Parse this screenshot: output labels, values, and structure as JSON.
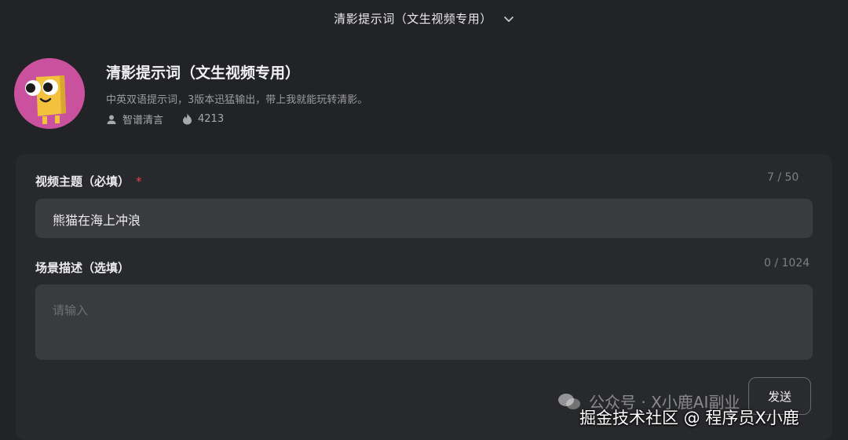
{
  "topbar": {
    "title": "清影提示词（文生视频专用）",
    "dropdown_icon": "chevron-down-icon"
  },
  "bot": {
    "name": "清影提示词（文生视频专用）",
    "description": "中英双语提示词，3版本迅猛输出，带上我就能玩转清影。",
    "author": "智谱清言",
    "author_icon": "user-icon",
    "heat": "4213",
    "heat_icon": "flame-icon",
    "avatar_color": "#c9519e",
    "avatar_figure_color": "#f2c23e"
  },
  "form": {
    "topic": {
      "label": "视频主题（必填）",
      "required_mark": "*",
      "counter": "7 / 50",
      "value": "熊猫在海上冲浪"
    },
    "scene": {
      "label": "场景描述（选填）",
      "counter": "0 / 1024",
      "placeholder": "请输入"
    },
    "send_label": "发送"
  },
  "watermark": {
    "line1": "公众号 · X小鹿AI副业",
    "line2": "掘金技术社区 @ 程序员X小鹿",
    "icon": "wechat-icon"
  },
  "colors": {
    "background": "#222326",
    "card": "#28292c",
    "input": "#3a3b3e",
    "required": "#e0444f"
  }
}
